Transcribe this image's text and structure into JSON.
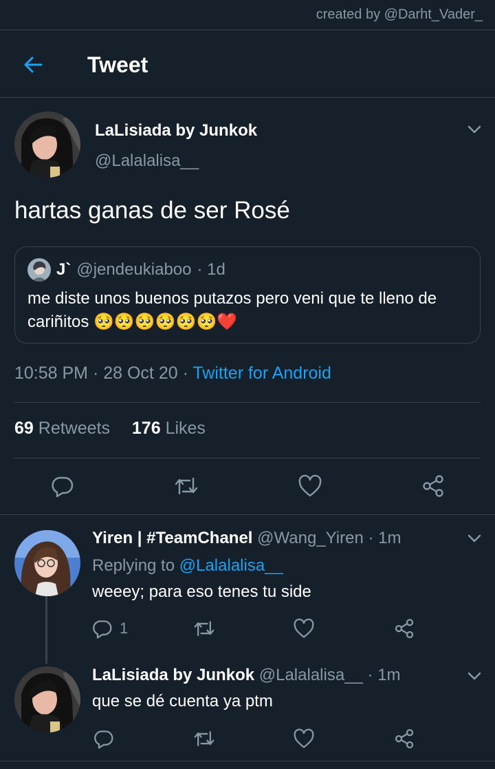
{
  "credit": "created by @Darht_Vader_",
  "header": {
    "title": "Tweet"
  },
  "tweet": {
    "author_name": "LaLisiada by Junkok",
    "author_handle": "@Lalalalisa__",
    "text": "hartas ganas de ser Rosé",
    "quote": {
      "name": "J`",
      "handle": "@jendeukiaboo",
      "time": "· 1d",
      "text_line1": "me diste unos buenos putazos pero veni que te lleno de",
      "text_line2": "cariñitos 🥺🥺🥺🥺🥺🥺❤️"
    },
    "time": "10:58 PM · 28 Oct 20 ·",
    "source": "Twitter for Android",
    "retweets_count": "69",
    "retweets_label": "Retweets",
    "likes_count": "176",
    "likes_label": "Likes"
  },
  "replies": [
    {
      "name": "Yiren | #TeamChanel",
      "handle": "@Wang_Yiren",
      "time": "· 1m",
      "replying_prefix": "Replying to",
      "replying_to": "@Lalalalisa__",
      "text": "weeey; para eso tenes tu side",
      "reply_count": "1"
    },
    {
      "name": "LaLisiada by Junkok",
      "handle": "@Lalalalisa__",
      "time": "· 1m",
      "text": "que se dé cuenta ya ptm"
    }
  ],
  "icons": {
    "back": "arrow-left-icon",
    "chevron": "chevron-down-icon",
    "reply": "reply-icon",
    "retweet": "retweet-icon",
    "like": "heart-icon",
    "share": "share-icon"
  },
  "colors": {
    "background": "#15202b",
    "accent": "#1da1f2",
    "muted": "#8899a6",
    "divider": "#38444d"
  }
}
